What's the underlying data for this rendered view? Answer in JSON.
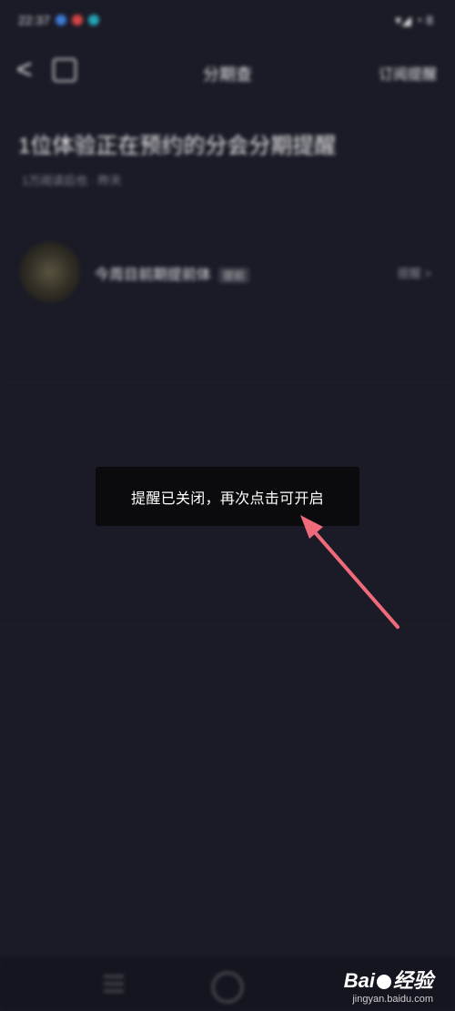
{
  "status_bar": {
    "time": "22:37",
    "right": "▾◢ ◔ 8"
  },
  "navbar": {
    "back_label": "<",
    "title": "分期查",
    "right_label": "订阅提醒"
  },
  "article": {
    "headline": "1位体验正在预约的分会分期提醒",
    "meta": "1万阅读后也 · 昨天"
  },
  "card": {
    "title": "今周目前期提前体",
    "tag": "提前",
    "right": "提醒 >"
  },
  "toast": {
    "text": "提醒已关闭，再次点击可开启"
  },
  "watermark": {
    "brand_left": "Bai",
    "brand_right": "经验",
    "url": "jingyan.baidu.com"
  },
  "colors": {
    "background": "#1b1b27",
    "toast_bg": "#0b0b0d",
    "arrow": "#ef6a7a"
  }
}
